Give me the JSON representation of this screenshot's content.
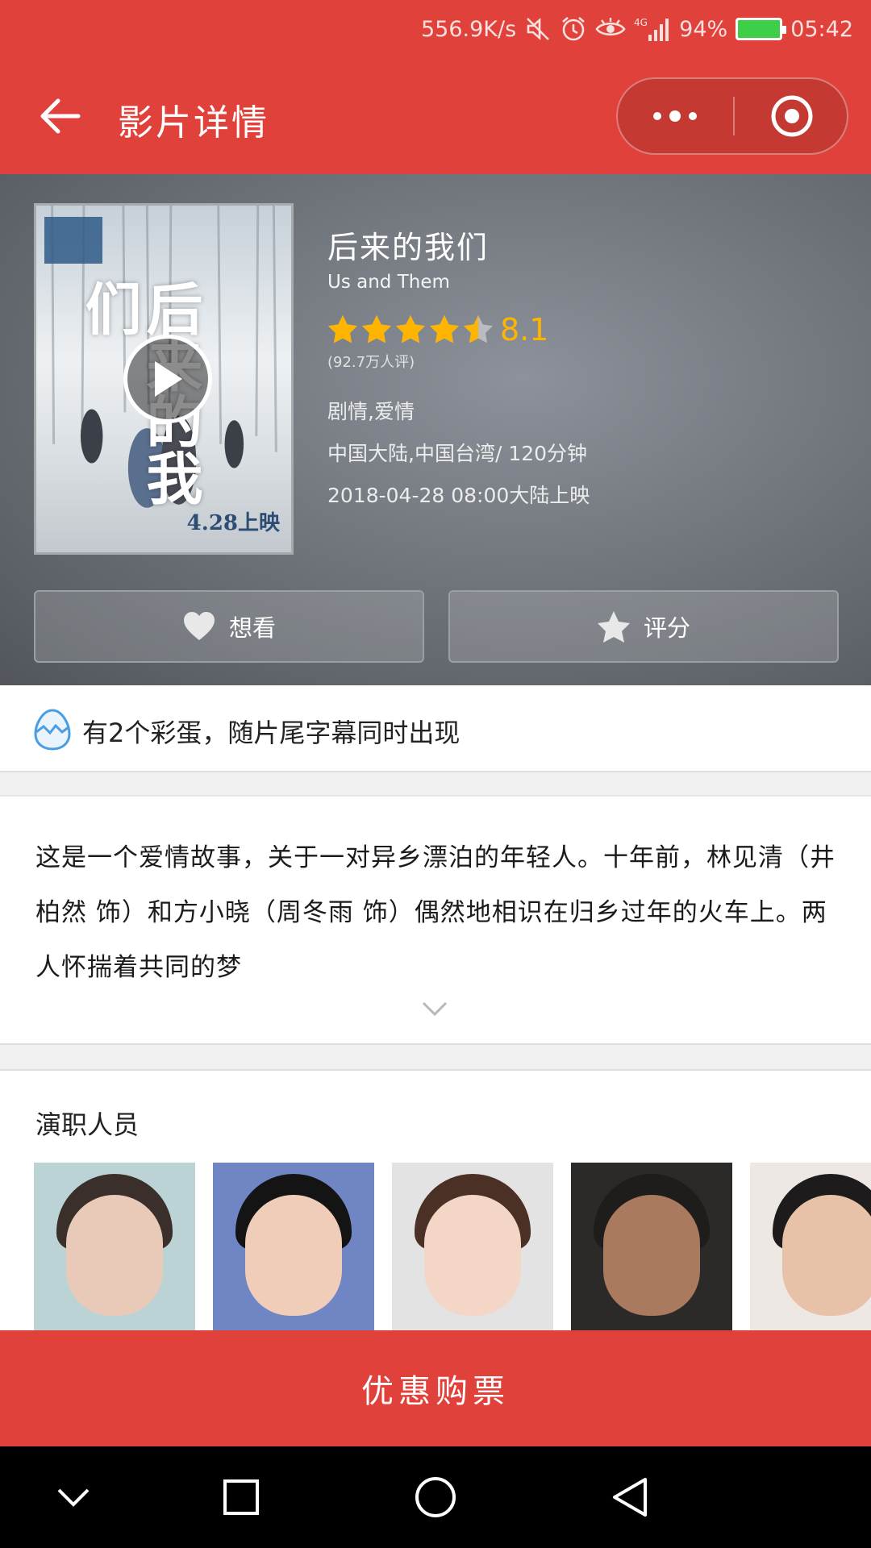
{
  "status_bar": {
    "net_speed": "556.9K/s",
    "battery_percent": "94%",
    "time": "05:42",
    "icons": [
      "mute-icon",
      "alarm-icon",
      "eye-icon",
      "4g-signal-icon",
      "battery-icon"
    ],
    "signal_label": "4G"
  },
  "title_bar": {
    "title": "影片详情",
    "back_icon": "arrow-left-icon",
    "more_icon": "more-dots-icon",
    "close_icon": "target-close-icon",
    "bg_color": "#e0423b"
  },
  "movie": {
    "title": "后来的我们",
    "title_en": "Us and Them",
    "score": "8.1",
    "stars": 4.5,
    "votes": "(92.7万人评)",
    "genre": "剧情,爱情",
    "region_duration": "中国大陆,中国台湾/ 120分钟",
    "release": "2018-04-28 08:00大陆上映",
    "poster": {
      "title_text": "后来的我们",
      "date_text": "4.28上映"
    }
  },
  "actions": {
    "want_label": "想看",
    "rate_label": "评分"
  },
  "egg": {
    "text": "有2个彩蛋，随片尾字幕同时出现"
  },
  "synopsis": {
    "text": "这是一个爱情故事，关于一对异乡漂泊的年轻人。十年前，林见清（井柏然 饰）和方小晓（周冬雨 饰）偶然地相识在归乡过年的火车上。两人怀揣着共同的梦"
  },
  "cast": {
    "title": "演职人员"
  },
  "buy": {
    "label": "优惠购票"
  },
  "nav": {
    "icons": [
      "chevron-down-icon",
      "square-recents-icon",
      "circle-home-icon",
      "triangle-back-icon"
    ]
  },
  "colors": {
    "accent": "#e0423b",
    "star": "#ffb400"
  }
}
